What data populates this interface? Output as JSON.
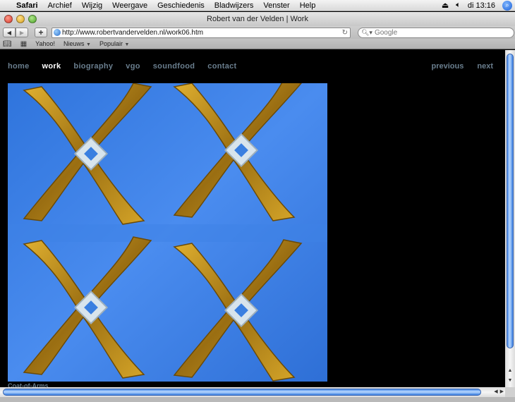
{
  "menubar": {
    "app": "Safari",
    "items": [
      "Archief",
      "Wijzig",
      "Weergave",
      "Geschiedenis",
      "Bladwijzers",
      "Venster",
      "Help"
    ],
    "clock": "di 13:16"
  },
  "window": {
    "title": "Robert van der Velden | Work"
  },
  "toolbar": {
    "url": "http://www.robertvandervelden.nl/work06.htm",
    "search_placeholder": "Google"
  },
  "bookmarks": {
    "items": [
      "Yahoo!",
      "Nieuws",
      "Populair"
    ]
  },
  "site": {
    "nav": [
      "home",
      "work",
      "biography",
      "vgo",
      "soundfood",
      "contact"
    ],
    "current": "work",
    "pager": {
      "previous": "previous",
      "next": "next"
    },
    "caption": "Coat-of-Arms"
  },
  "colors": {
    "canvas_blue": "#3a7fe0",
    "gold": "#b88a1e",
    "link_gray": "#6a7e8e"
  },
  "icons": {
    "apple": "apple-icon",
    "volume": "volume-icon",
    "eject": "eject-icon",
    "spotlight": "spotlight-icon",
    "globe": "globe-icon",
    "reload": "reload-icon"
  }
}
